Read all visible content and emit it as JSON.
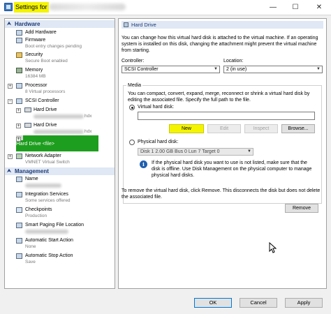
{
  "window": {
    "title": "Settings for",
    "minimize_glyph": "—",
    "maximize_glyph": "☐",
    "close_glyph": "✕"
  },
  "tree": {
    "hardware_section": "Hardware",
    "management_section": "Management",
    "hardware": [
      {
        "name": "add-hardware",
        "label": "Add Hardware",
        "sub": ""
      },
      {
        "name": "firmware",
        "label": "Firmware",
        "sub": "Boot entry changes pending"
      },
      {
        "name": "security",
        "label": "Security",
        "sub": "Secure Boot enabled"
      },
      {
        "name": "memory",
        "label": "Memory",
        "sub": "16384 MB"
      },
      {
        "name": "processor",
        "label": "Processor",
        "sub": "8 Virtual processors"
      },
      {
        "name": "scsi-controller",
        "label": "SCSI Controller",
        "sub": ""
      },
      {
        "name": "hard-drive-1",
        "label": "Hard Drive",
        "sub": "hdx"
      },
      {
        "name": "hard-drive-2",
        "label": "Hard Drive",
        "sub": "hdx"
      },
      {
        "name": "hard-drive-selected",
        "label": "Hard Drive",
        "sub": "<file>"
      },
      {
        "name": "network-adapter",
        "label": "Network Adapter",
        "sub": "VMNET Virtual Switch"
      }
    ],
    "management": [
      {
        "name": "name",
        "label": "Name",
        "sub": ""
      },
      {
        "name": "integration-services",
        "label": "Integration Services",
        "sub": "Some services offered"
      },
      {
        "name": "checkpoints",
        "label": "Checkpoints",
        "sub": "Production"
      },
      {
        "name": "smart-paging",
        "label": "Smart Paging File Location",
        "sub": ""
      },
      {
        "name": "automatic-start",
        "label": "Automatic Start Action",
        "sub": "None"
      },
      {
        "name": "automatic-stop",
        "label": "Automatic Stop Action",
        "sub": "Save"
      }
    ]
  },
  "panel": {
    "header": "Hard Drive",
    "intro": "You can change how this virtual hard disk is attached to the virtual machine. If an operating system is installed on this disk, changing the attachment might prevent the virtual machine from starting.",
    "controller_label": "Controller:",
    "controller_value": "SCSI Controller",
    "location_label": "Location:",
    "location_value": "2 (in use)",
    "media_label": "Media",
    "media_text": "You can compact, convert, expand, merge, reconnect or shrink a virtual hard disk by editing the associated file. Specify the full path to the file.",
    "virtual_hard_disk_label": "Virtual hard disk:",
    "virtual_hard_disk_value": "",
    "new_button": "New",
    "edit_button": "Edit",
    "inspect_button": "Inspect",
    "browse_button": "Browse...",
    "physical_hard_disk_label": "Physical hard disk:",
    "physical_disk_value": "Disk 1 2.00 GB Bus 0 Lun 7 Target 0",
    "info_text": "If the physical hard disk you want to use is not listed, make sure that the disk is offline. Use Disk Management on the physical computer to manage physical hard disks.",
    "remove_text": "To remove the virtual hard disk, click Remove. This disconnects the disk but does not delete the associated file.",
    "remove_button": "Remove"
  },
  "footer": {
    "ok": "OK",
    "cancel": "Cancel",
    "apply": "Apply"
  },
  "colors": {
    "selection": "#1e9e1e",
    "highlight": "#f4f400",
    "section_bg": "#dfe8f4",
    "section_text": "#1e3a78"
  },
  "icons": [
    "settings-app-icon",
    "hardware-icon",
    "firmware-icon",
    "security-icon",
    "memory-icon",
    "processor-icon",
    "controller-icon",
    "hard-drive-icon",
    "network-icon",
    "info-icon",
    "mouse-cursor-icon"
  ]
}
